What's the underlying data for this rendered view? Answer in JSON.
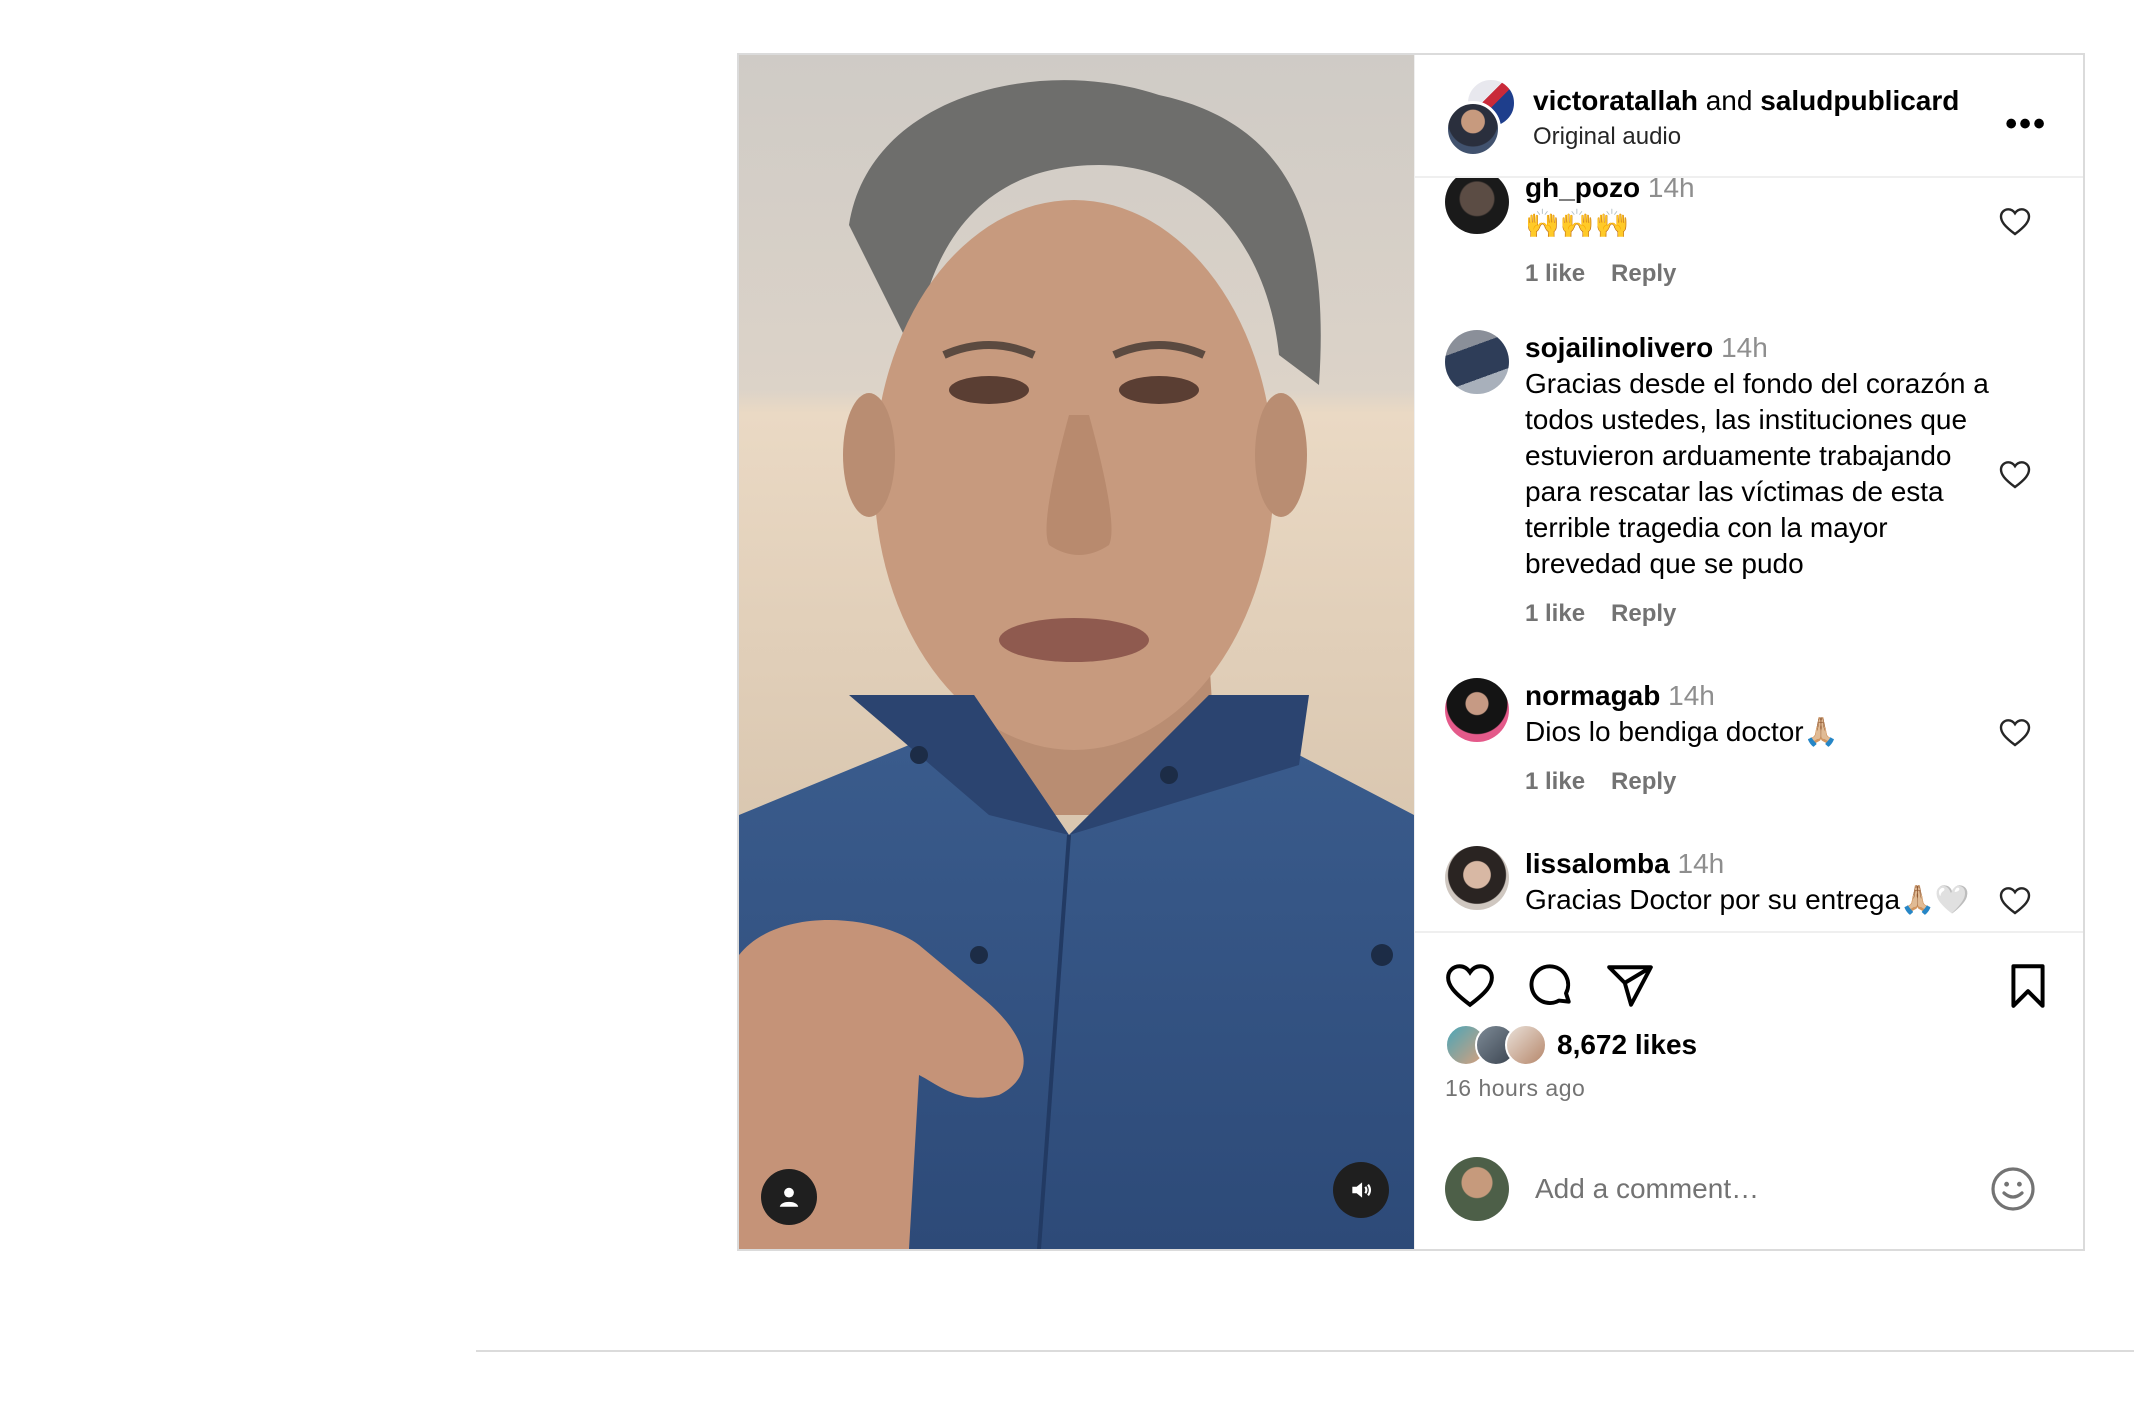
{
  "header": {
    "user1": "victoratallah",
    "joiner": "and",
    "user2": "saludpublicard",
    "audio": "Original audio"
  },
  "comments": [
    {
      "user": "gh_pozo",
      "time": "14h",
      "text": "🙌🙌🙌",
      "likes": "1 like",
      "reply": "Reply"
    },
    {
      "user": "sojailinolivero",
      "time": "14h",
      "text": "Gracias desde el fondo del corazón a todos ustedes, las instituciones que estuvieron arduamente trabajando para rescatar las víctimas de esta terrible tragedia con la mayor brevedad que se pudo",
      "likes": "1 like",
      "reply": "Reply"
    },
    {
      "user": "normagab",
      "time": "14h",
      "text": "Dios lo bendiga doctor🙏🏼",
      "likes": "1 like",
      "reply": "Reply"
    },
    {
      "user": "lissalomba",
      "time": "14h",
      "text": "Gracias Doctor por su entrega🙏🏼🤍"
    }
  ],
  "post": {
    "likes": "8,672 likes",
    "time_ago": "16 hours ago"
  },
  "composer": {
    "placeholder": "Add a comment…"
  },
  "icons": {
    "more": "more-options-icon",
    "like": "heart-icon",
    "comment": "comment-icon",
    "share": "share-icon",
    "save": "bookmark-icon",
    "emoji": "emoji-icon",
    "tags": "user-tag-icon",
    "audio": "speaker-icon"
  },
  "colors": {
    "text": "#000000",
    "muted": "#737373",
    "border": "#dbdbdb"
  }
}
